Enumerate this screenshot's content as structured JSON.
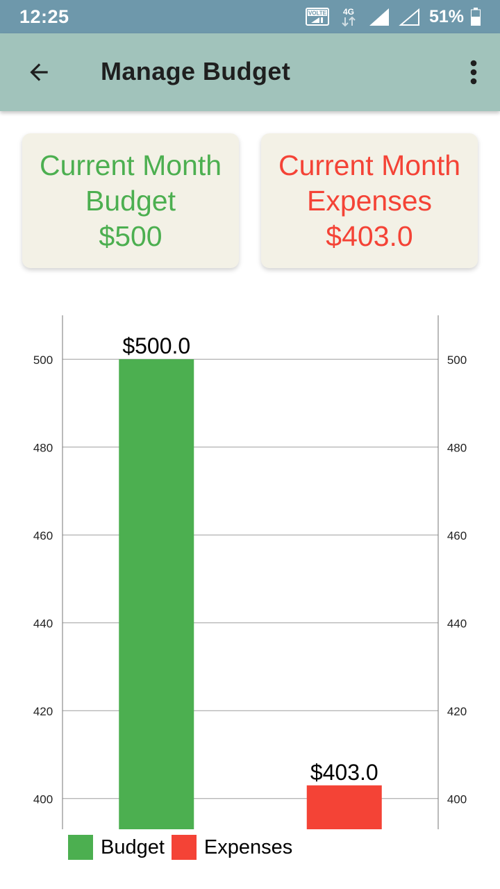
{
  "status_bar": {
    "time": "12:25",
    "volte_label": "VOLTE",
    "network_label": "4G",
    "battery_percent": "51%",
    "icons": [
      "volte-icon",
      "4g-data-icon",
      "signal-full-icon",
      "signal-empty-icon",
      "battery-icon"
    ]
  },
  "app_bar": {
    "title": "Manage Budget",
    "back_icon": "arrow-back-icon",
    "menu_icon": "more-vert-icon"
  },
  "cards": {
    "budget": {
      "line1": "Current Month",
      "line2": "Budget",
      "value": "$500",
      "color": "#4caf50"
    },
    "expenses": {
      "line1": "Current Month",
      "line2": "Expenses",
      "value": "$403.0",
      "color": "#f44336"
    }
  },
  "chart_data": {
    "type": "bar",
    "categories": [
      "Budget",
      "Expenses"
    ],
    "values": [
      500.0,
      403.0
    ],
    "data_labels": [
      "$500.0",
      "$403.0"
    ],
    "colors": [
      "#4caf50",
      "#f44336"
    ],
    "y_ticks": [
      "400",
      "420",
      "440",
      "460",
      "480",
      "500"
    ],
    "ylim": [
      393,
      510
    ],
    "y_axis_left": true,
    "y_axis_right": true,
    "grid": true,
    "legend_position": "bottom-left",
    "legend": [
      {
        "label": "Budget",
        "color": "#4caf50"
      },
      {
        "label": "Expenses",
        "color": "#f44336"
      }
    ]
  }
}
